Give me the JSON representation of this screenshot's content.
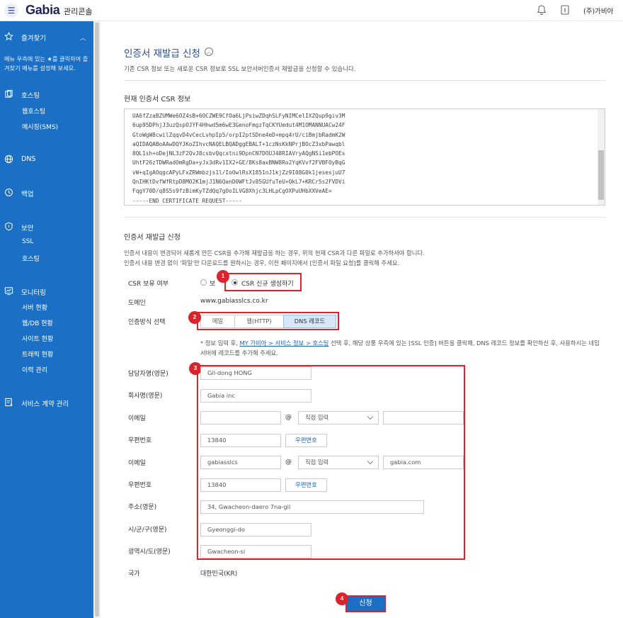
{
  "topbar": {
    "logo": "Gabia",
    "logo_sub": "관리콘솔",
    "user": "(주)가비아"
  },
  "sidebar": {
    "favorites": "즐겨찾기",
    "favorites_note": "메뉴 우측에 있는 ★를 클릭하여 즐겨찾기 메뉴를 설정해 보세요.",
    "hosting": "호스팅",
    "hosting_subs": [
      "웹호스팅",
      "메시징(SMS)"
    ],
    "dns": "DNS",
    "backup": "백업",
    "security": "보안",
    "security_subs": [
      "SSL",
      "호스팅"
    ],
    "monitoring": "모니터링",
    "monitoring_subs": [
      "서버 현황",
      "웹/DB 현황",
      "사이트 현황",
      "트래픽 현황",
      "이력 관리"
    ],
    "contract": "서비스 계약 관리"
  },
  "page": {
    "title": "인증서 재발급 신청",
    "desc": "기존 CSR 정보 또는 새로운 CSR 정보로 SSL 보안서버인증서 재발급을 신청할 수 있습니다.",
    "csr_title": "현재 인증서 CSR 정보",
    "csr_lines": [
      "UA6fZzaBZUMWe6OZ4sB+6OCZWE9CfOa6LjPsiwZDqhSLFyNIMCelIXZQup9giv3M",
      "6up95DPhjJ3uzQspOJYF4Hhwd5m6wE3GenoFmgzTqCKYUedut4M1OMANNUACw24F",
      "GtoWgW8cwilZqqvD4vCecLvhpIp5/orpI2ptSDne4eD+mpq4rU/ciBmjbRadmK2W",
      "aQIDAQABoAAwDQYJKoZIhvcNAQELBQADggEBALT+1czNsKkNPrjBOcZ3xbPawqbl",
      "8QL1sh+oDejNL3zF2QvJ8csbvQqcxtni9DpnCN7DOUJ48RIAVryAQgNSi1ebPOEs",
      "UhtF26zTDWRadOmRgDa+yJx3dRv1IX2+GE/8Ks8axBNW8Ro2YqKVvf2FVBFOyBqG",
      "vW+qIgAOqgcAPyLFxZRWmbzjs1l/IoOwlRsX1851nJ1kjZz9I08G0k1jesesjuU7",
      "QnIHKtDvfWfRtpD8MO2K1mjJ1N6QanD0WFtJv85GUfuTeU+QkL7+KRCr5s2FVDVi",
      "FqgY70D/q8S5s9fzBimKyTZdQq7gOoILVG8Xhjc3LHLpCgOXPuUHbXXVeAE=",
      "-----END CERTIFICATE REQUEST-----"
    ],
    "reissue_title": "인증서 재발급 신청",
    "info1": "인증서 내용이 변경되어 새롭게 만든 CSR을 추가해 재발급을 하는 경우, 위의 현재 CSR과 다른 파일로 추가하셔야 합니다.",
    "info2": "인증서 내용 변경 없이 '파일'만 다운로드를 원하시는 경우, 이전 페이지에서 [인증서 파일 요청]를 클릭해 주세요."
  },
  "form": {
    "csr_label": "CSR 보유 여부",
    "csr_opt1": "보",
    "csr_opt2": "CSR 신규 생성하기",
    "domain_label": "도메인",
    "domain_value": "www.gabiasslcs.co.kr",
    "auth_label": "인증방식 선택",
    "auth_tabs": [
      "메일",
      "웹(HTTP)",
      "DNS 레코드"
    ],
    "note_pre": "* 정보 입력 후, ",
    "note_link": "MY 가비아 > 서비스 정보 > 호스팅",
    "note_post": " 선택 후, 해당 상품 우측에 있는 [SSL 인증] 버튼을 클릭해, DNS 레코드 정보를 확인하신 후, 사용하시는 네임서버에 레코드를 추가해 주세요.",
    "contact_label": "담당자명(영문)",
    "contact_value": "Gil-dong HONG",
    "company_label": "회사명(영문)",
    "company_value": "Gabia inc",
    "email_label": "이메일",
    "email1_local": "",
    "email_at": "@",
    "email_select": "직접 입력",
    "email1_domain": "",
    "postal_label": "우편번호",
    "postal1_value": "13840",
    "postal_btn": "우편번호",
    "email2_local": "gabiasslcs",
    "email2_domain": "gabia.com",
    "postal2_value": "13840",
    "address_label": "주소(영문)",
    "address_value": "34, Gwacheon-daero 7na-gil",
    "city_label": "시/군/구(영문)",
    "city_value": "Gyeonggi-do",
    "province_label": "광역시/도(영문)",
    "province_value": "Gwacheon-si",
    "country_label": "국가",
    "country_value": "대한민국(KR)",
    "submit": "신청"
  },
  "badges": [
    "1",
    "2",
    "3",
    "4"
  ],
  "colors": {
    "sidebar": "#1b6fc4",
    "accent": "#2a4d8c",
    "highlight": "#d9232d"
  }
}
